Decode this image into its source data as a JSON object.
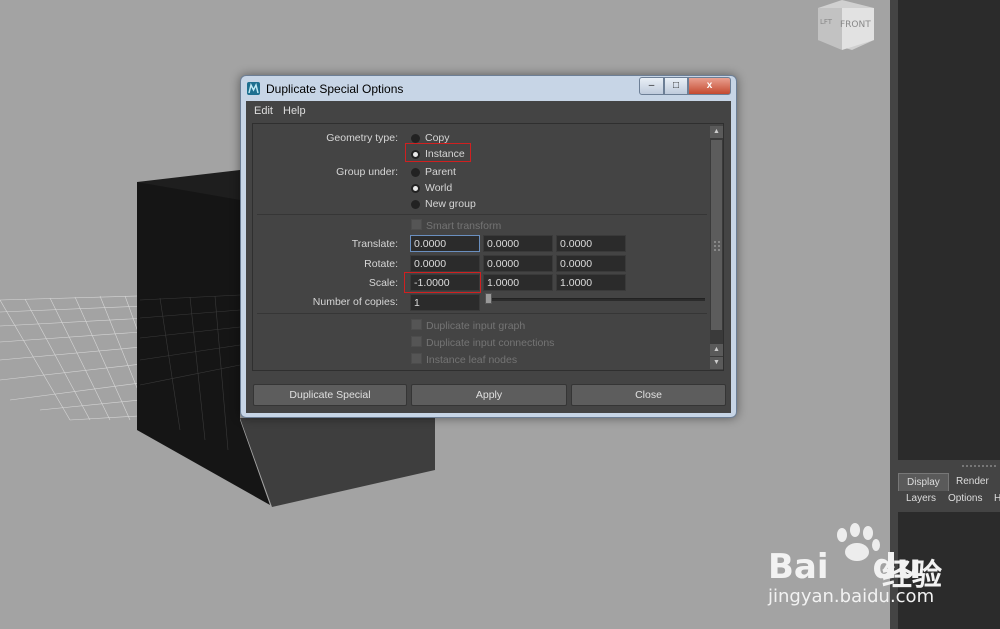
{
  "viewcube": {
    "left_face": "LFT",
    "front_face": "FRONT"
  },
  "dialog": {
    "title": "Duplicate Special Options",
    "window_controls": {
      "minimize": "‒",
      "maximize": "□",
      "close": "x"
    },
    "menu": [
      "Edit",
      "Help"
    ],
    "geometry_type": {
      "label": "Geometry type:",
      "options": [
        "Copy",
        "Instance"
      ],
      "selected": "Instance"
    },
    "group_under": {
      "label": "Group under:",
      "options": [
        "Parent",
        "World",
        "New group"
      ],
      "selected": "World"
    },
    "smart_transform": {
      "label": "Smart transform",
      "checked": false,
      "enabled": false
    },
    "translate": {
      "label": "Translate:",
      "values": [
        "0.0000",
        "0.0000",
        "0.0000"
      ]
    },
    "rotate": {
      "label": "Rotate:",
      "values": [
        "0.0000",
        "0.0000",
        "0.0000"
      ]
    },
    "scale": {
      "label": "Scale:",
      "values": [
        "-1.0000",
        "1.0000",
        "1.0000"
      ]
    },
    "copies": {
      "label": "Number of copies:",
      "value": "1"
    },
    "duplicate_input_graph": {
      "label": "Duplicate input graph",
      "checked": false,
      "enabled": false
    },
    "duplicate_input_connections": {
      "label": "Duplicate input connections",
      "checked": false,
      "enabled": false
    },
    "instance_leaf_nodes": {
      "label": "Instance leaf nodes",
      "checked": false,
      "enabled": false
    },
    "buttons": {
      "duplicate_special": "Duplicate Special",
      "apply": "Apply",
      "close": "Close"
    }
  },
  "right_panel": {
    "tabs": [
      "Display",
      "Render"
    ],
    "active_tab": "Display",
    "menu": [
      "Layers",
      "Options",
      "H"
    ]
  },
  "watermark": {
    "brand": "Bai",
    "brand2": "du",
    "cn": "经验",
    "url": "jingyan.baidu.com"
  },
  "colors": {
    "highlight_box": "#d02020",
    "panel_bg": "#444444",
    "field_bg": "#2b2b2b"
  }
}
